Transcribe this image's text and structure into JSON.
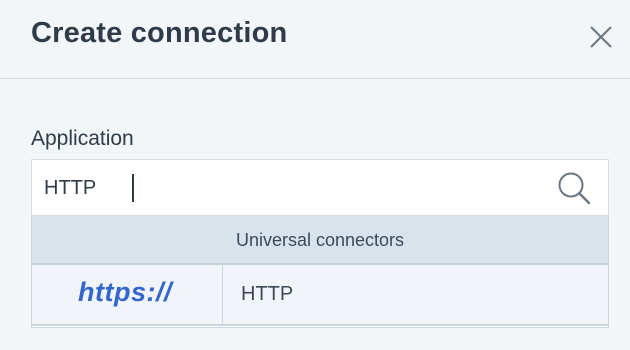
{
  "dialog": {
    "title": "Create connection",
    "close_icon": "close-icon"
  },
  "application": {
    "label": "Application",
    "search_value": "HTTP",
    "search_icon": "search-icon"
  },
  "results": {
    "group_title": "Universal connectors",
    "items": [
      {
        "logo_text": "https://",
        "label": "HTTP"
      }
    ]
  },
  "colors": {
    "background": "#f3f6f9",
    "group_header_bg": "#d9e3ec",
    "logo_blue": "#3366cc",
    "text": "#2f3b48"
  }
}
